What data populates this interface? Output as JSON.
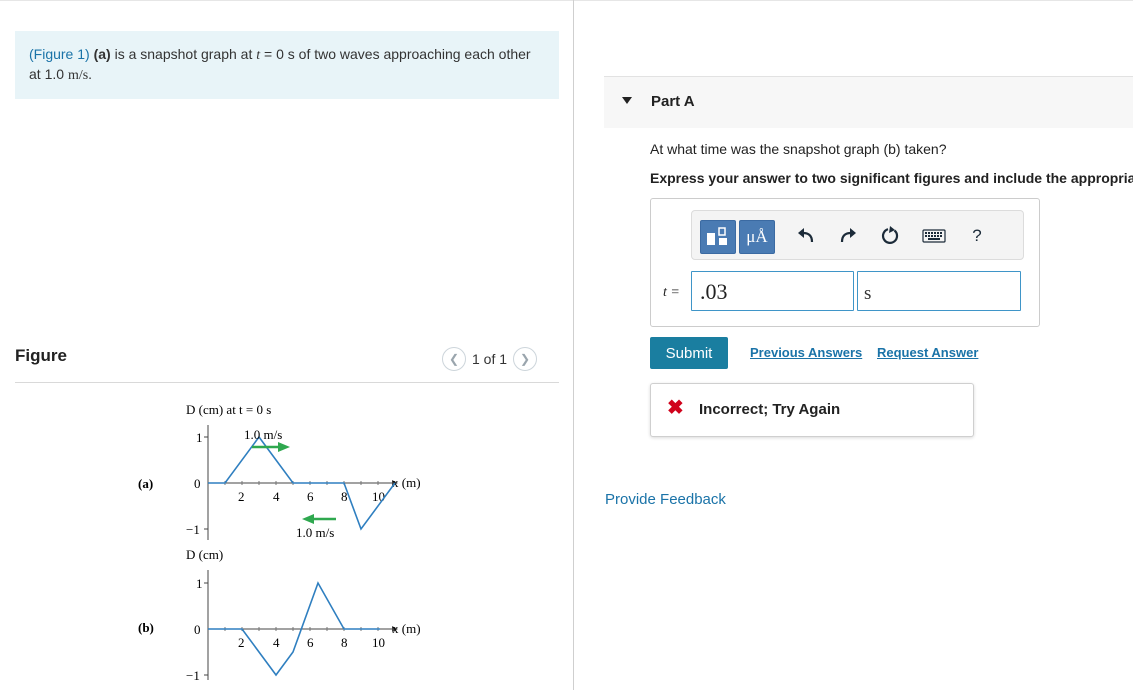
{
  "intro": {
    "figure_link": "(Figure 1)",
    "part_label": "(a)",
    "text_before_t": " is a snapshot graph at ",
    "t_symbol": "t",
    "text_after_t": " = 0 s of two waves approaching each other at ",
    "speed": "1.0",
    "speed_unit": "m/s",
    "end": "."
  },
  "figure": {
    "label": "Figure",
    "pager_text": "1 of 1",
    "prev_icon": "chevron-left-icon",
    "next_icon": "chevron-right-icon",
    "graph_a": {
      "panel_label": "(a)",
      "y_title": "D (cm) at t = 0 s",
      "y_ticks": [
        "1",
        "0",
        "−1"
      ],
      "x_label": "x (m)",
      "x_ticks": [
        "2",
        "4",
        "6",
        "8",
        "10"
      ],
      "speed_top": "1.0 m/s",
      "speed_bottom": "1.0 m/s"
    },
    "graph_b": {
      "panel_label": "(b)",
      "y_title": "D (cm)",
      "y_ticks": [
        "1",
        "0",
        "−1"
      ],
      "x_label": "x (m)",
      "x_ticks": [
        "2",
        "4",
        "6",
        "8",
        "10"
      ]
    },
    "colors": {
      "wave": "#2f7fc0",
      "arrow": "#2fa84f"
    }
  },
  "part": {
    "title": "Part A"
  },
  "question": "At what time was the snapshot graph (b) taken?",
  "instruction": "Express your answer to two significant figures and include the appropriate units.",
  "toolbar": {
    "icons": [
      "templates-icon",
      "units-icon",
      "undo-icon",
      "redo-icon",
      "reset-icon",
      "keyboard-icon",
      "help-icon"
    ],
    "units_label": "μÅ",
    "help_label": "?"
  },
  "answer": {
    "variable_label": "t =",
    "value": ".03",
    "unit": "s"
  },
  "buttons": {
    "submit": "Submit",
    "previous_answers": "Previous Answers",
    "request_answer": "Request Answer"
  },
  "feedback": {
    "icon": "x-icon",
    "text": "Incorrect; Try Again"
  },
  "provide_feedback": "Provide Feedback"
}
